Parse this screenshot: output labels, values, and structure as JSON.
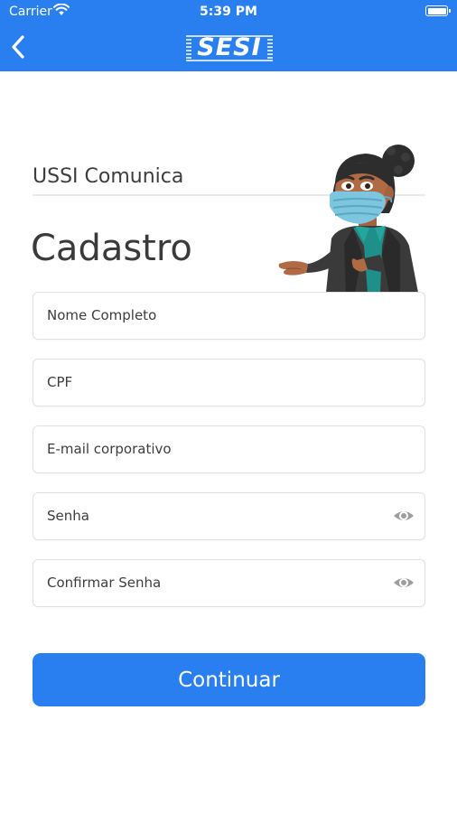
{
  "status_bar": {
    "carrier": "Carrier",
    "time": "5:39 PM",
    "icons": [
      "wifi-icon",
      "battery-icon"
    ]
  },
  "header": {
    "back_icon": "chevron-left-icon",
    "logo_text": "SESI",
    "brand_color": "#2a7ff0"
  },
  "page": {
    "subtitle": "USSI Comunica",
    "title": "Cadastro",
    "illustration": "woman-with-mask-illustration"
  },
  "form": {
    "full_name": {
      "placeholder": "Nome Completo",
      "value": ""
    },
    "cpf": {
      "placeholder": "CPF",
      "value": ""
    },
    "email": {
      "placeholder": "E-mail corporativo",
      "value": ""
    },
    "password": {
      "placeholder": "Senha",
      "value": "",
      "icon": "eye-icon"
    },
    "confirm_password": {
      "placeholder": "Confirmar Senha",
      "value": "",
      "icon": "eye-icon"
    }
  },
  "actions": {
    "continue_label": "Continuar"
  }
}
